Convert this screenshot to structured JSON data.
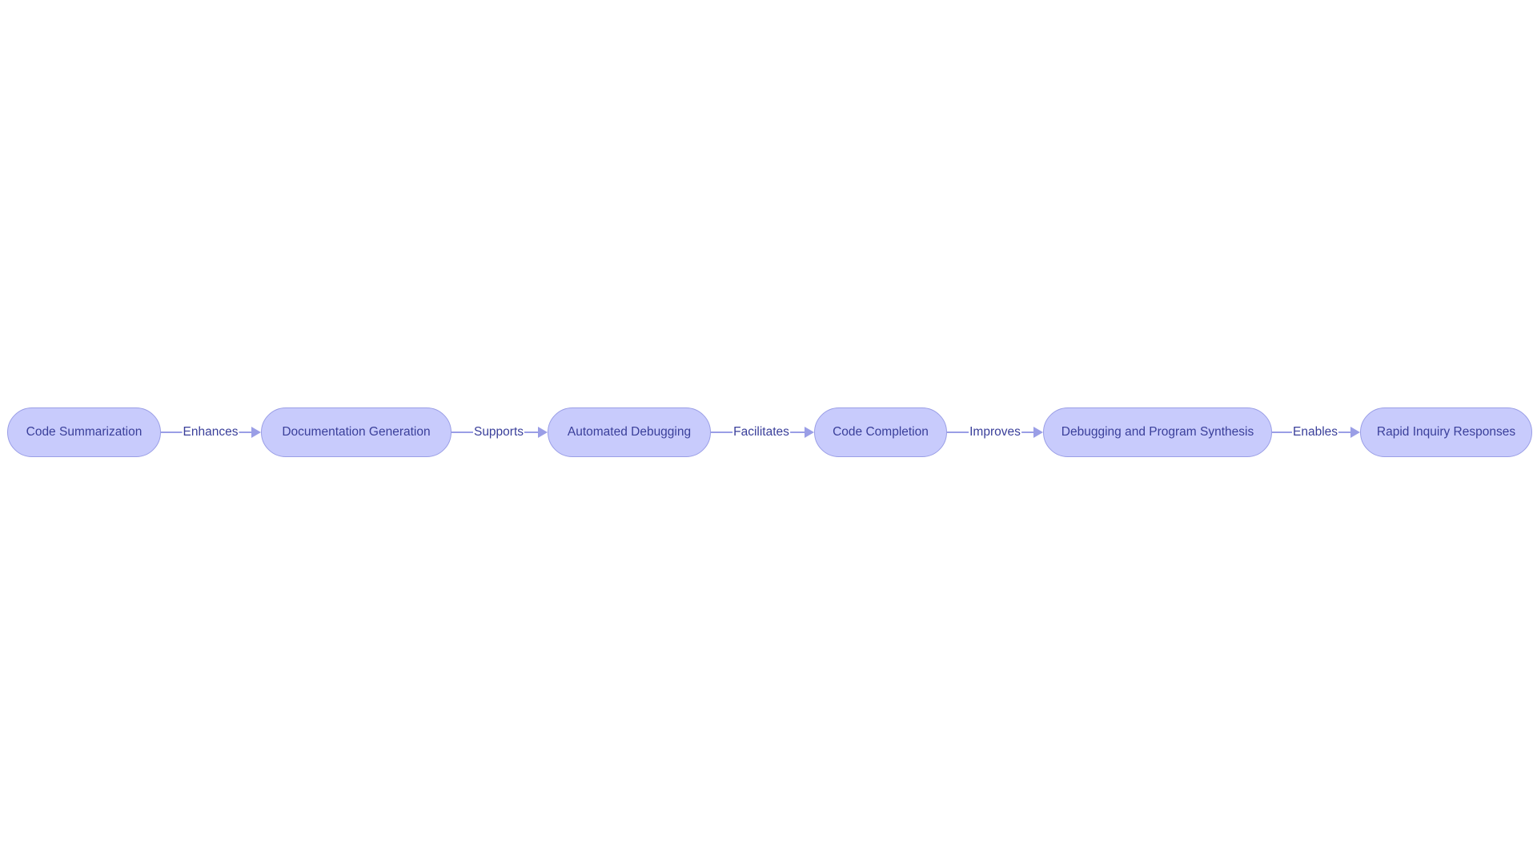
{
  "diagram": {
    "type": "flowchart",
    "direction": "left-to-right",
    "colors": {
      "node_fill": "#c8cbfc",
      "node_border": "#9a9ee6",
      "edge": "#9a9ee6",
      "text": "#3a3f9a",
      "background": "#ffffff"
    },
    "nodes": [
      {
        "id": "n1",
        "label": "Code Summarization"
      },
      {
        "id": "n2",
        "label": "Documentation Generation"
      },
      {
        "id": "n3",
        "label": "Automated Debugging"
      },
      {
        "id": "n4",
        "label": "Code Completion"
      },
      {
        "id": "n5",
        "label": "Debugging and Program Synthesis"
      },
      {
        "id": "n6",
        "label": "Rapid Inquiry Responses"
      }
    ],
    "edges": [
      {
        "from": "n1",
        "to": "n2",
        "label": "Enhances"
      },
      {
        "from": "n2",
        "to": "n3",
        "label": "Supports"
      },
      {
        "from": "n3",
        "to": "n4",
        "label": "Facilitates"
      },
      {
        "from": "n4",
        "to": "n5",
        "label": "Improves"
      },
      {
        "from": "n5",
        "to": "n6",
        "label": "Enables"
      }
    ]
  }
}
